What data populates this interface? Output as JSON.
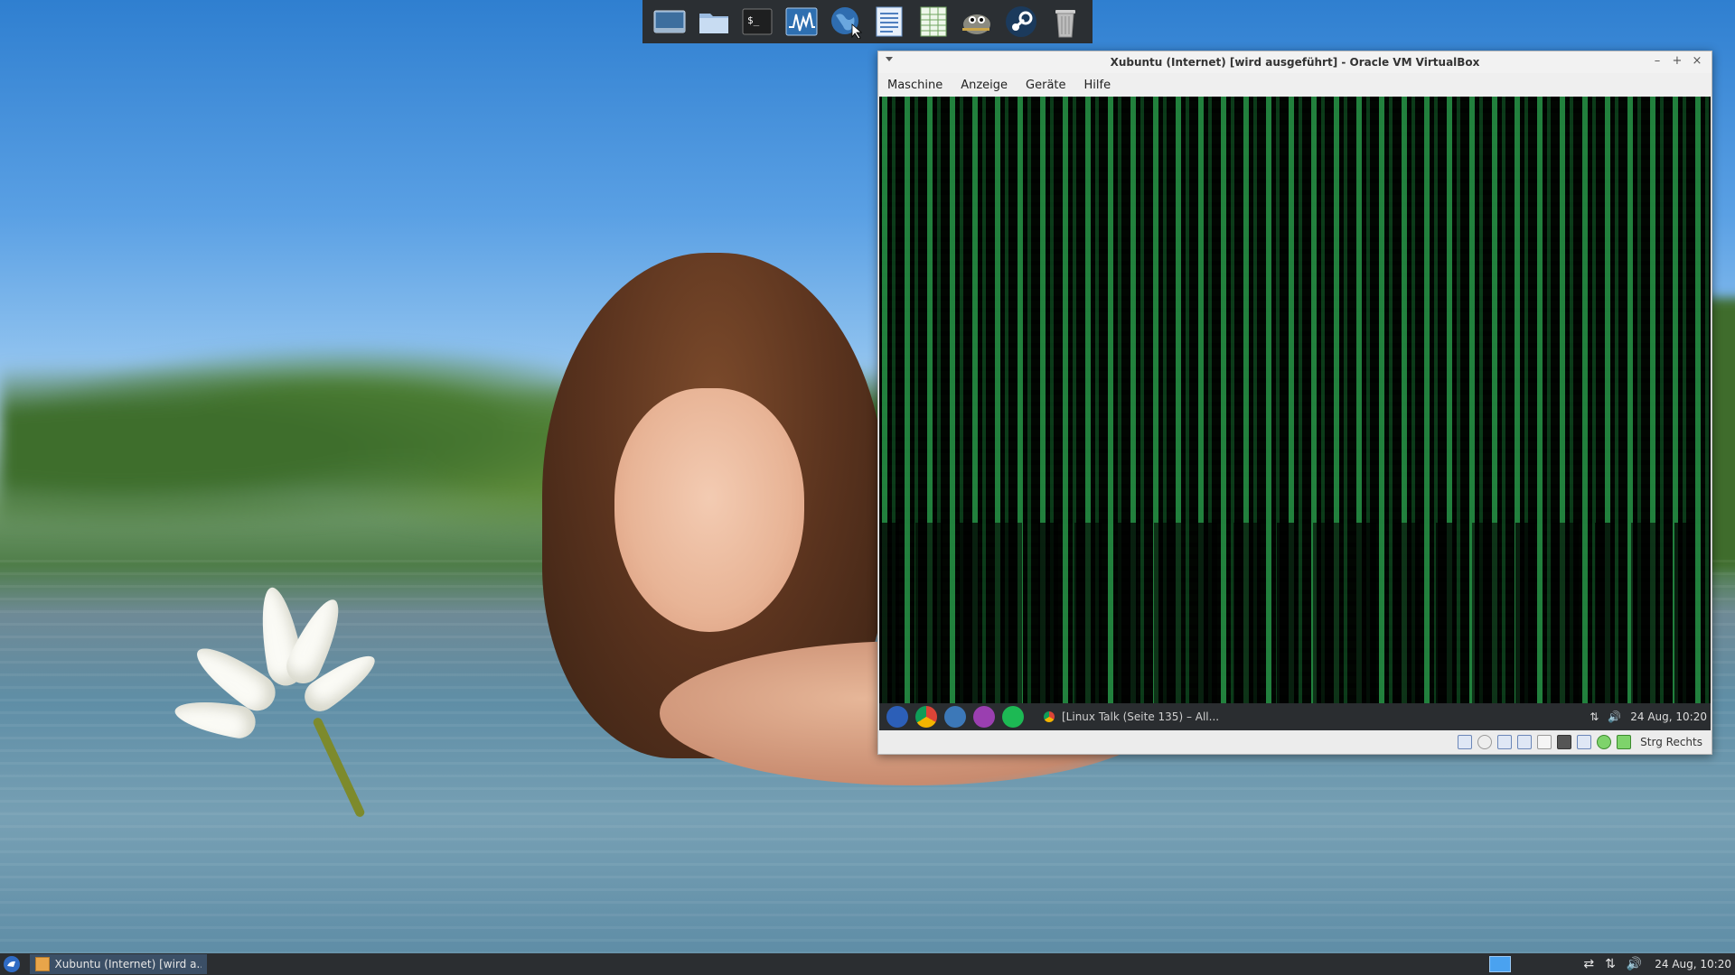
{
  "dock": {
    "items": [
      {
        "name": "show-desktop-icon"
      },
      {
        "name": "file-manager-icon"
      },
      {
        "name": "terminal-icon",
        "glyph": "$_"
      },
      {
        "name": "system-monitor-icon"
      },
      {
        "name": "web-browser-icon"
      },
      {
        "name": "text-document-icon"
      },
      {
        "name": "spreadsheet-icon"
      },
      {
        "name": "gimp-icon"
      },
      {
        "name": "steam-icon"
      },
      {
        "name": "trash-icon"
      }
    ]
  },
  "vbox": {
    "title": "Xubuntu (Internet) [wird ausgeführt] - Oracle VM VirtualBox",
    "controls": {
      "minimize": "–",
      "maximize": "+",
      "close": "×"
    },
    "menu": [
      "Maschine",
      "Anzeige",
      "Geräte",
      "Hilfe"
    ],
    "guest_panel": {
      "task_label": "[Linux Talk (Seite 135) – All...",
      "clock": "24 Aug, 10:20"
    },
    "statusbar": {
      "host_key": "Strg Rechts"
    }
  },
  "host_panel": {
    "task_label": "Xubuntu (Internet) [wird a...",
    "clock": "24 Aug, 10:20"
  },
  "colors": {
    "panel": "#2b2e31",
    "matrix_green": "#3ce66e",
    "workspace_active": "#4aa2f0"
  }
}
